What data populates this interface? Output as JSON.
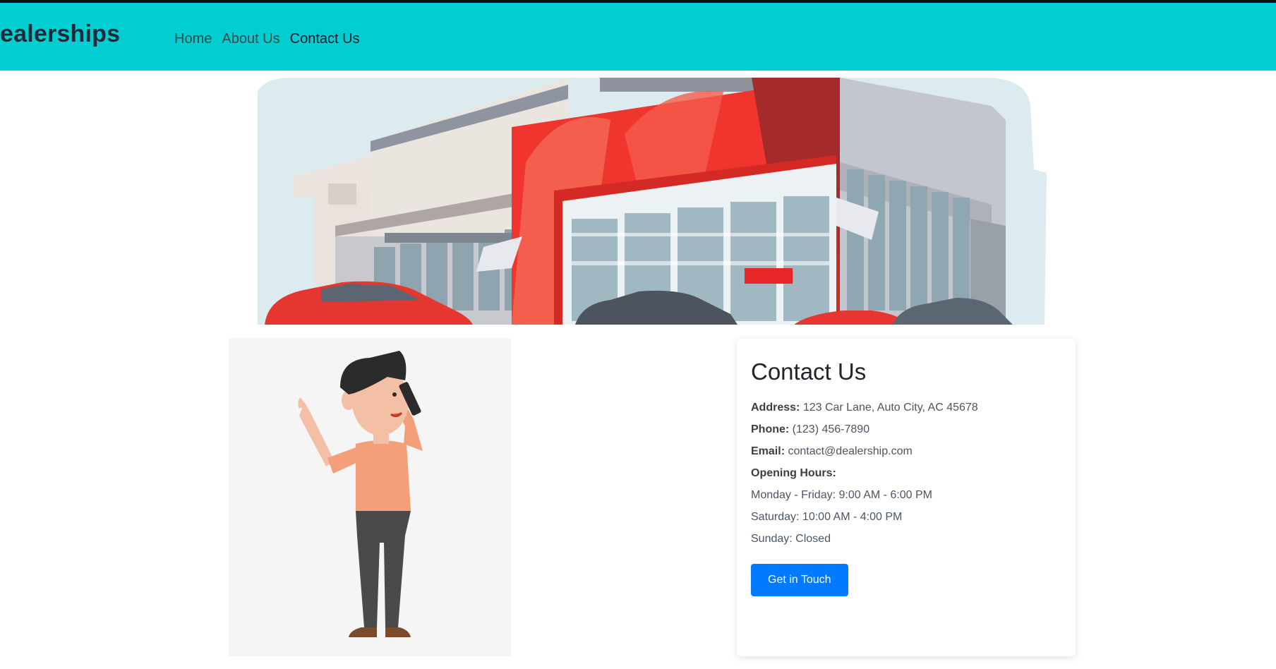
{
  "navbar": {
    "brand": "ealerships",
    "links": [
      {
        "label": "Home"
      },
      {
        "label": "About Us"
      },
      {
        "label": "Contact Us"
      }
    ]
  },
  "contact": {
    "title": "Contact Us",
    "address_label": "Address:",
    "address_value": "123 Car Lane, Auto City, AC 45678",
    "phone_label": "Phone:",
    "phone_value": "(123) 456-7890",
    "email_label": "Email:",
    "email_value": "contact@dealership.com",
    "hours_label": "Opening Hours:",
    "hours": [
      "Monday - Friday: 9:00 AM - 6:00 PM",
      "Saturday: 10:00 AM - 4:00 PM",
      "Sunday: Closed"
    ],
    "button_label": "Get in Touch"
  },
  "images": {
    "hero_icon": "dealership-building-illustration",
    "person_icon": "man-on-phone-illustration"
  },
  "colors": {
    "navbar": "#00ced1",
    "accent_button": "#007bff",
    "building_red": "#f0342e"
  }
}
